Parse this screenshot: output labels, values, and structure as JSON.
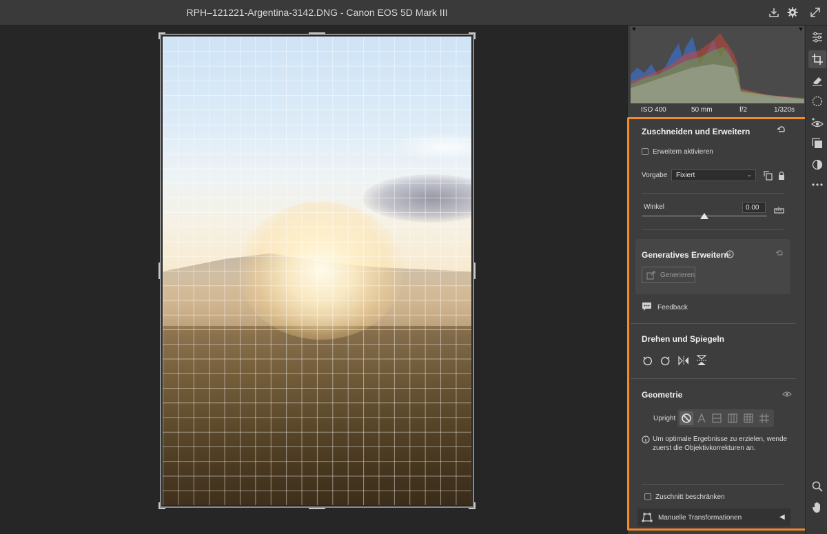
{
  "window": {
    "title": "RPH–121221-Argentina-3142.DNG  -  Canon EOS 5D Mark III"
  },
  "exif": {
    "iso": "ISO 400",
    "focal": "50 mm",
    "aperture": "f/2",
    "shutter": "1/320s"
  },
  "crop_section": {
    "title": "Zuschneiden und Erweitern",
    "expand_checkbox_label": "Erweitern aktivieren",
    "expand_checked": false,
    "preset_label": "Vorgabe",
    "preset_value": "Fixiert",
    "angle_label": "Winkel",
    "angle_value": "0.00",
    "angle_slider_fraction": 0.5
  },
  "generative_section": {
    "title": "Generatives Erweitern",
    "generate_label": "Generieren"
  },
  "feedback_label": "Feedback",
  "rotate_section": {
    "title": "Drehen und Spiegeln"
  },
  "geometry_section": {
    "title": "Geometrie",
    "upright_label": "Upright",
    "hint_text_line1": "Um optimale Ergebnisse zu erzielen, wende",
    "hint_text_line2": "zuerst die Objektivkorrekturen an.",
    "constrain_label": "Zuschnitt beschränken",
    "constrain_checked": false
  },
  "manual_transform_label": "Manuelle Transformationen",
  "colors": {
    "highlight": "#f08a2a",
    "panel": "#3d3d3d",
    "background": "#262626"
  }
}
